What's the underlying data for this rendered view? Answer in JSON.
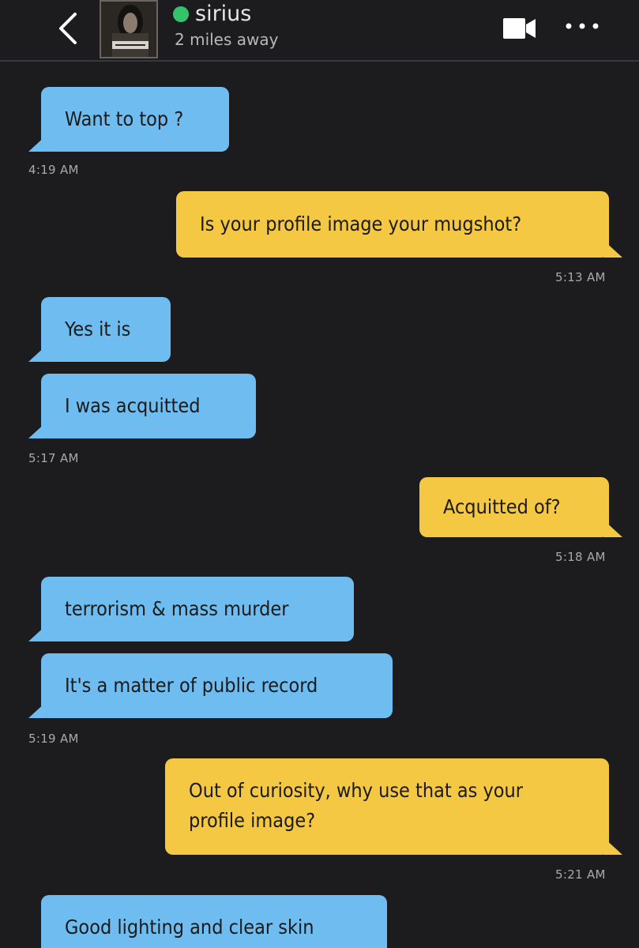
{
  "header": {
    "contact_name": "sirius",
    "distance": "2 miles away",
    "online_color": "#35c26d",
    "back_icon": "chevron-left-icon",
    "video_icon": "video-camera-icon",
    "more_icon": "more-dots-icon"
  },
  "messages": [
    {
      "direction": "in",
      "text": "Want to top ?"
    },
    {
      "direction": "in_time",
      "text": "4:19 AM"
    },
    {
      "direction": "out",
      "text": "Is your profile image your mugshot?"
    },
    {
      "direction": "out_time",
      "text": "5:13 AM"
    },
    {
      "direction": "in",
      "text": "Yes it is"
    },
    {
      "direction": "in",
      "text": "I was acquitted"
    },
    {
      "direction": "in_time",
      "text": "5:17 AM"
    },
    {
      "direction": "out",
      "text": "Acquitted of?"
    },
    {
      "direction": "out_time",
      "text": "5:18 AM"
    },
    {
      "direction": "in",
      "text": "terrorism & mass murder"
    },
    {
      "direction": "in",
      "text": "It's a matter of public record"
    },
    {
      "direction": "in_time",
      "text": "5:19 AM"
    },
    {
      "direction": "out",
      "text": "Out of curiosity, why use that as your profile image?"
    },
    {
      "direction": "out_time",
      "text": "5:21 AM"
    },
    {
      "direction": "in",
      "text": "Good lighting and clear skin"
    }
  ],
  "colors": {
    "background": "#1c1c1e",
    "incoming_bubble": "#6fbcf0",
    "outgoing_bubble": "#f5c844"
  }
}
